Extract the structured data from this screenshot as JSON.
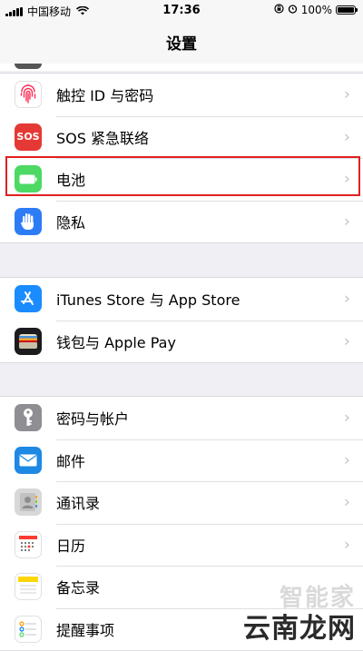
{
  "status": {
    "carrier": "中国移动",
    "time": "17:36",
    "battery_percent": "100%"
  },
  "nav": {
    "title": "设置"
  },
  "groups": [
    {
      "items": [
        {
          "label": "触控 ID 与密码",
          "icon": "fingerprint-icon",
          "color": "#ff3b30"
        },
        {
          "label": "SOS 紧急联络",
          "icon": "sos-icon",
          "color": "#e53935",
          "icon_text": "SOS"
        },
        {
          "label": "电池",
          "icon": "battery-icon",
          "color": "#4cd964"
        },
        {
          "label": "隐私",
          "icon": "hand-icon",
          "color": "#2d7cf6"
        }
      ]
    },
    {
      "items": [
        {
          "label": "iTunes Store 与 App Store",
          "icon": "app-store-icon",
          "color": "#1a8cff"
        },
        {
          "label": "钱包与 Apple Pay",
          "icon": "wallet-icon",
          "color": "#1c1c1e"
        }
      ]
    },
    {
      "items": [
        {
          "label": "密码与帐户",
          "icon": "key-icon",
          "color": "#8e8e93"
        },
        {
          "label": "邮件",
          "icon": "mail-icon",
          "color": "#1e88e5"
        },
        {
          "label": "通讯录",
          "icon": "contacts-icon",
          "color": "#b8b8b8"
        },
        {
          "label": "日历",
          "icon": "calendar-icon",
          "color": "#ffffff"
        },
        {
          "label": "备忘录",
          "icon": "notes-icon",
          "color": "#ffffff"
        },
        {
          "label": "提醒事项",
          "icon": "reminders-icon",
          "color": "#ffffff"
        }
      ]
    }
  ],
  "watermark": {
    "top": "智能家",
    "bottom": "云南龙网"
  },
  "colors": {
    "highlight": "#e02020",
    "background": "#efeff4"
  }
}
